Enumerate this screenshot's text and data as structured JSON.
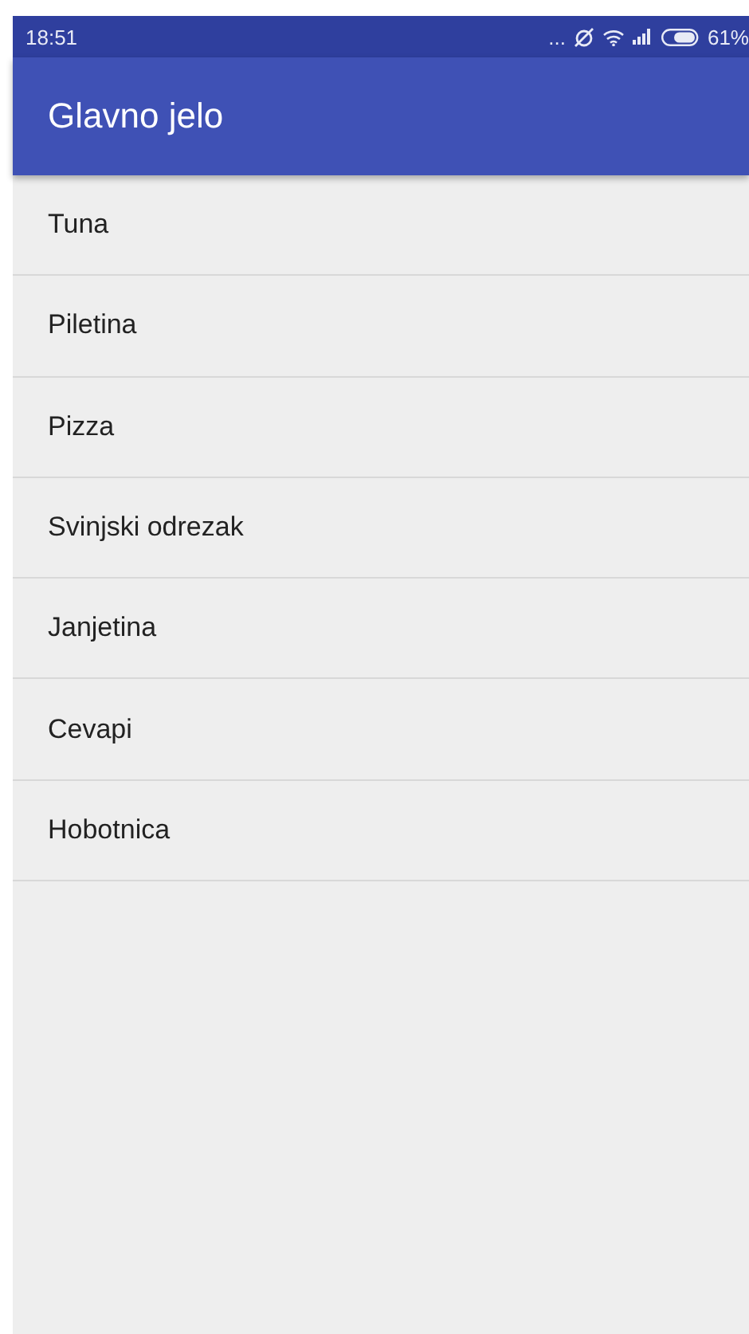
{
  "status_bar": {
    "time": "18:51",
    "more": "...",
    "battery": "61%"
  },
  "app_bar": {
    "title": "Glavno jelo"
  },
  "list": {
    "items": [
      {
        "label": "Tuna"
      },
      {
        "label": "Piletina"
      },
      {
        "label": "Pizza"
      },
      {
        "label": "Svinjski odrezak"
      },
      {
        "label": "Janjetina"
      },
      {
        "label": "Cevapi"
      },
      {
        "label": "Hobotnica"
      }
    ]
  }
}
